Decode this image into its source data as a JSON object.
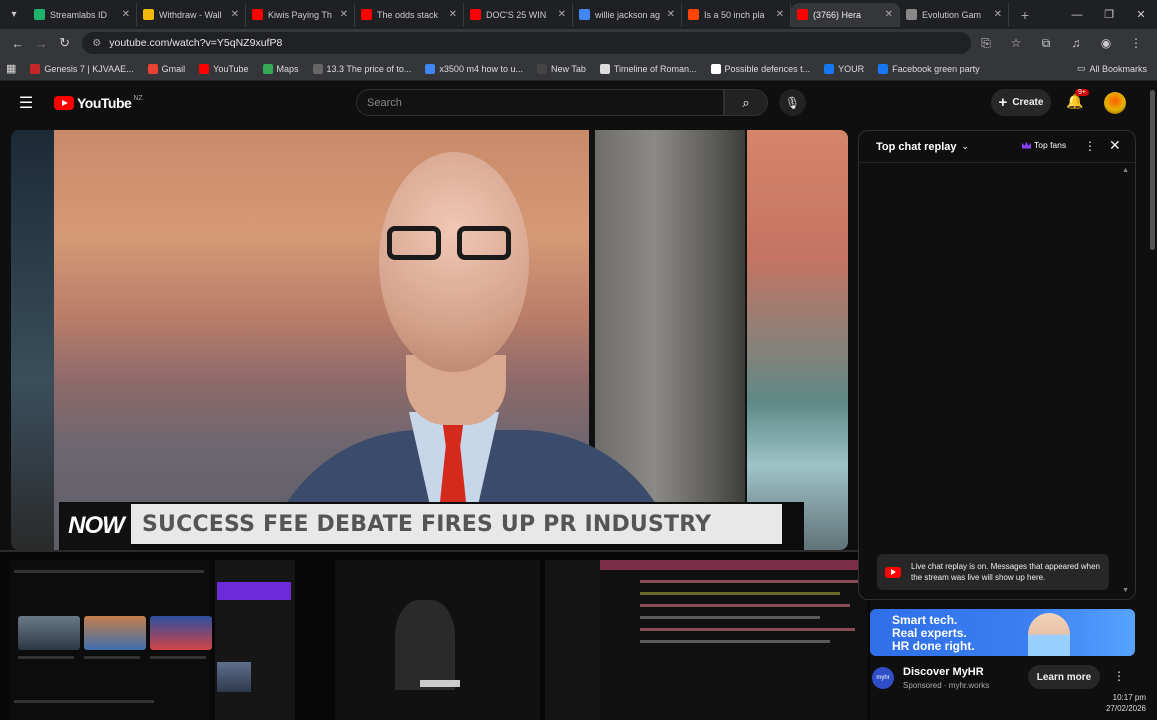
{
  "browser": {
    "tabs": [
      {
        "title": "Streamlabs ID",
        "color": "#1fb370"
      },
      {
        "title": "Withdraw - Wall",
        "color": "#f0b90b"
      },
      {
        "title": "Kiwis Paying Th",
        "color": "#ff0000"
      },
      {
        "title": "The odds stack",
        "color": "#ff0000"
      },
      {
        "title": "DOC'S 25 WIN",
        "color": "#ff0000"
      },
      {
        "title": "willie jackson ag",
        "color": "#4285f4"
      },
      {
        "title": "Is a 50 inch pla",
        "color": "#ff4500"
      },
      {
        "title": "(3766) Hera",
        "color": "#ff0000"
      },
      {
        "title": "Evolution Gam",
        "color": "#888888"
      }
    ],
    "url": "youtube.com/watch?v=Y5qNZ9xufP8",
    "bookmarks": [
      {
        "label": "Genesis 7 | KJVAAE...",
        "color": "#c62828"
      },
      {
        "label": "Gmail",
        "color": "#ea4335"
      },
      {
        "label": "YouTube",
        "color": "#ff0000"
      },
      {
        "label": "Maps",
        "color": "#34a853"
      },
      {
        "label": "13.3 The price of to...",
        "color": "#666666"
      },
      {
        "label": "x3500 m4 how to u...",
        "color": "#4285f4"
      },
      {
        "label": "New Tab",
        "color": "#444444"
      },
      {
        "label": "Timeline of Roman...",
        "color": "#dddddd"
      },
      {
        "label": "Possible defences t...",
        "color": "#ffffff"
      },
      {
        "label": "YOUR",
        "color": "#1877f2"
      },
      {
        "label": "Facebook green party",
        "color": "#1877f2"
      }
    ],
    "all_bookmarks": "All Bookmarks"
  },
  "youtube": {
    "logo": "YouTube",
    "country": "NZ",
    "search_placeholder": "Search",
    "create_label": "Create",
    "notifications_badge": "9+"
  },
  "video": {
    "now_label": "NOW",
    "headline": "SUCCESS FEE DEBATE FIRES UP PR INDUSTRY"
  },
  "chat": {
    "title": "Top chat replay",
    "top_fans_label": "Top fans",
    "notice": "Live chat replay is on. Messages that appeared when the stream was live will show up here."
  },
  "ad": {
    "banner_text": [
      "Smart tech.",
      "Real experts.",
      "HR done right."
    ],
    "logo_text": "myhr",
    "name": "Discover MyHR",
    "sponsored": "Sponsored · myhr.works",
    "cta": "Learn more"
  },
  "taskbar": {
    "time": "10:17 pm",
    "date": "27/02/2026"
  }
}
